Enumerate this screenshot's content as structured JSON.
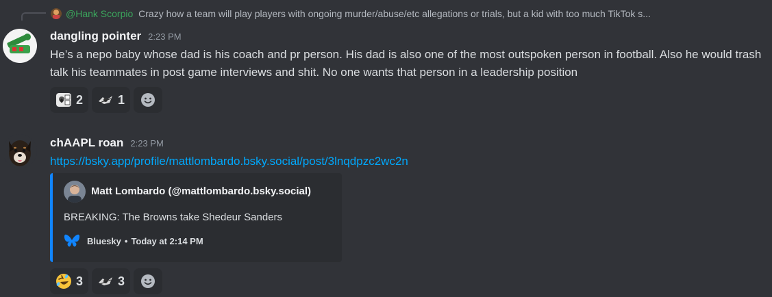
{
  "reply": {
    "author": "@Hank Scorpio",
    "text": "Crazy how a team will play players with ongoing murder/abuse/etc allegations or trials, but a kid with too much TikTok s..."
  },
  "messages": [
    {
      "username": "dangling pointer",
      "timestamp": "2:23 PM",
      "text": "He’s a nepo baby whose dad is his coach and pr person. His dad is also one of the most outspoken person in football. Also he would trash talk his teammates in post game interviews and shit. No one wants that person in a leadership position",
      "reactions": [
        {
          "emoji": "scream-sticker",
          "count": "2"
        },
        {
          "emoji": "flying-meme",
          "count": "1"
        }
      ]
    },
    {
      "username": "chAAPL roan",
      "timestamp": "2:23 PM",
      "link": "https://bsky.app/profile/mattlombardo.bsky.social/post/3lnqdpzc2wc2n",
      "embed": {
        "author": "Matt Lombardo (@mattlombardo.bsky.social)",
        "description": "BREAKING: The Browns take Shedeur Sanders",
        "provider": "Bluesky",
        "separator": "•",
        "time": "Today at 2:14 PM",
        "accent": "#1185fe"
      },
      "reactions": [
        {
          "emoji": "rolling-on-floor-laughing",
          "count": "3"
        },
        {
          "emoji": "flying-meme",
          "count": "3"
        }
      ]
    }
  ],
  "colors": {
    "background": "#313338",
    "reply_author": "#3ba55c",
    "link": "#00a8fc"
  }
}
